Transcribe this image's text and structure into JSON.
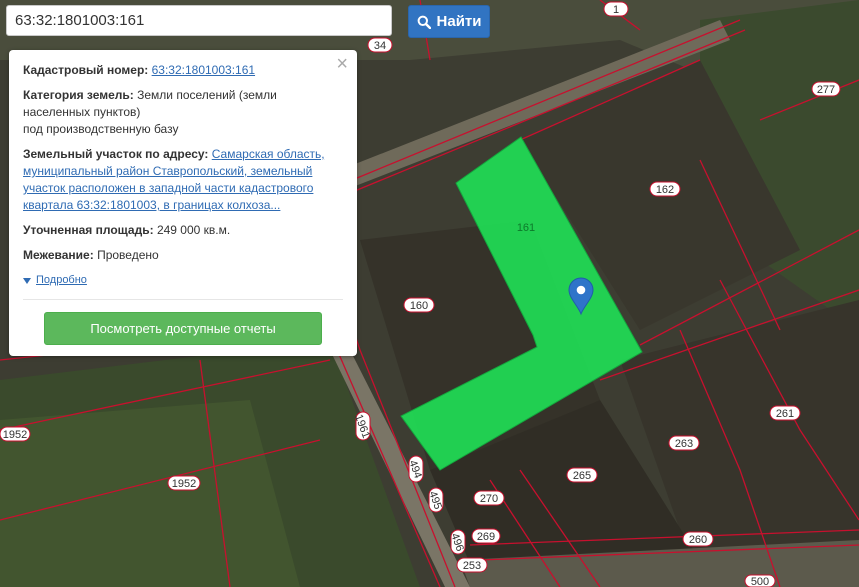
{
  "search": {
    "value": "63:32:1801003:161",
    "button_label": "Найти"
  },
  "popup": {
    "cadastral_label": "Кадастровый номер:",
    "cadastral_value": "63:32:1801003:161",
    "category_label": "Категория земель:",
    "category_value_1": "Земли поселений (земли",
    "category_value_2": "населенных пунктов)",
    "category_value_3": "под производственную базу",
    "address_label": "Земельный участок по адресу:",
    "address_1": "Самарская область,",
    "address_2": "муниципальный район Ставропольский, земельный",
    "address_3": "участок расположен в западной части кадастрового",
    "address_4": "квартала 63:32:1801003, в границах колхоза...",
    "area_label": "Уточненная площадь:",
    "area_value": "249 000 кв.м.",
    "survey_label": "Межевание:",
    "survey_value": "Проведено",
    "details_label": "Подробно",
    "report_button": "Посмотреть доступные отчеты"
  },
  "parcels": {
    "p1": "1",
    "p34": "34",
    "p277": "277",
    "p162": "162",
    "p161": "161",
    "p160": "160",
    "p261": "261",
    "p263": "263",
    "p265": "265",
    "p270": "270",
    "p260": "260",
    "p269": "269",
    "p253": "253",
    "p500": "500",
    "p1952a": "1952",
    "p1952b": "1952",
    "p1961": "1961",
    "p494": "494",
    "p495": "495",
    "p496": "496"
  },
  "colors": {
    "highlight": "#1fdc55",
    "border": "#c8102e",
    "button_blue": "#3174c2",
    "button_green": "#5cb85c"
  },
  "icons": [
    "search-icon",
    "close-icon",
    "map-marker-icon",
    "caret-down-icon"
  ]
}
